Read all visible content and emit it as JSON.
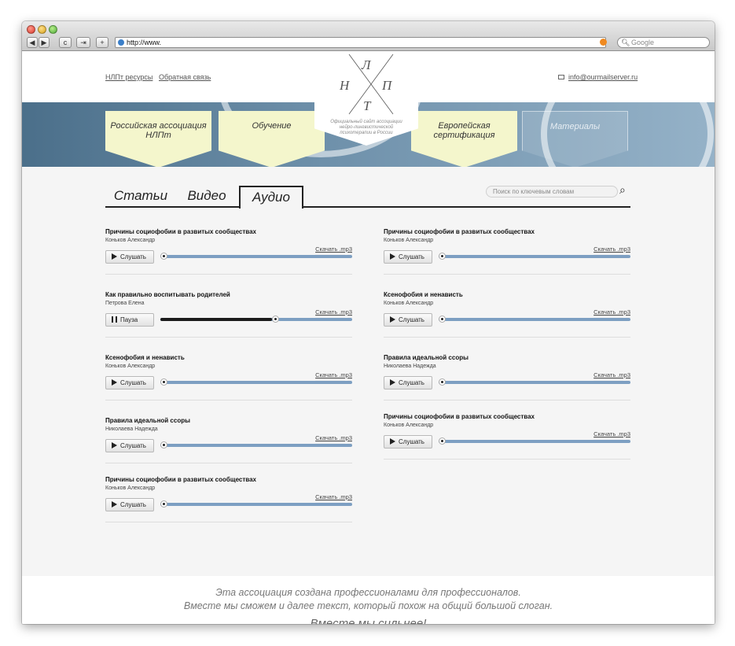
{
  "browser": {
    "url": "http://www.",
    "search_placeholder": "Google",
    "back_label": "◀",
    "forward_label": "▶",
    "reload_label": "c",
    "share_label": "⇥",
    "add_label": "+"
  },
  "header": {
    "links": [
      "НЛПт ресурсы",
      "Обратная связь"
    ],
    "email": "info@ourmailserver.ru",
    "logo_letters": [
      "Л",
      "Н",
      "П",
      "Т"
    ],
    "logo_caption": "Официальный сайт ассоциации нейро-лингвистической психотерапии в России"
  },
  "menu": [
    {
      "label": "Российская ассоциация НЛПт"
    },
    {
      "label": "Обучение"
    },
    {
      "label": "Европейская сертификация"
    },
    {
      "label": "Материалы"
    }
  ],
  "tabs": [
    "Статьи",
    "Видео",
    "Аудио"
  ],
  "active_tab": "Аудио",
  "search": {
    "placeholder": "Поиск по ключевым словам"
  },
  "download_label": "Скачать .mp3",
  "left_tracks": [
    {
      "title": "Причины социофобии в развитых сообществах",
      "author": "Коньков Александр",
      "button": "Слушать",
      "state": "stopped",
      "progress": 0
    },
    {
      "title": "Как правильно воспитывать родителей",
      "author": "Петрова Елена",
      "button": "Пауза",
      "state": "playing",
      "progress": 0.58
    },
    {
      "title": "Ксенофобия и ненависть",
      "author": "Коньков Александр",
      "button": "Слушать",
      "state": "stopped",
      "progress": 0
    },
    {
      "title": "Правила идеальной ссоры",
      "author": "Николаева Надежда",
      "button": "Слушать",
      "state": "stopped",
      "progress": 0
    },
    {
      "title": "Причины социофобии в развитых сообществах",
      "author": "Коньков Александр",
      "button": "Слушать",
      "state": "stopped",
      "progress": 0
    }
  ],
  "right_tracks": [
    {
      "title": "Причины социофобии в развитых сообществах",
      "author": "Коньков Александр",
      "button": "Слушать",
      "state": "stopped",
      "progress": 0
    },
    {
      "title": "Ксенофобия и ненависть",
      "author": "Коньков Александр",
      "button": "Слушать",
      "state": "stopped",
      "progress": 0
    },
    {
      "title": "Правила идеальной ссоры",
      "author": "Николаева Надежда",
      "button": "Слушать",
      "state": "stopped",
      "progress": 0
    },
    {
      "title": "Причины социофобии в развитых сообществах",
      "author": "Коньков Александр",
      "button": "Слушать",
      "state": "stopped",
      "progress": 0
    }
  ],
  "footer": {
    "line1": "Эта ассоциация создана профессионалами для профессионалов.",
    "line2": "Вместе мы сможем и далее текст, который похож на общий большой слоган.",
    "line3": "Вместе мы сильнее!"
  },
  "colors": {
    "accent_blue": "#7d9fc2",
    "menu_yellow": "#f4f6cc",
    "banner_blue": "#6f91ab"
  }
}
